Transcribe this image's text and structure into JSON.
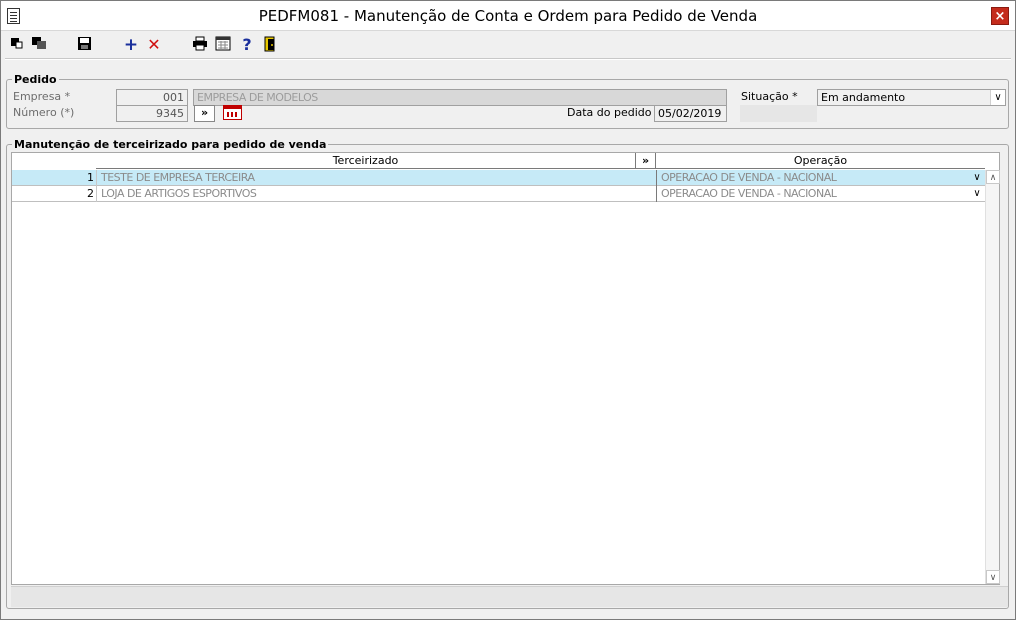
{
  "window": {
    "title": "PEDFM081 - Manutenção de Conta e Ordem para Pedido de Venda",
    "close_label": "×"
  },
  "toolbar": {
    "plus_label": "+",
    "x_label": "✕",
    "help_label": "?"
  },
  "pedido": {
    "group_title": "Pedido",
    "empresa_label": "Empresa *",
    "empresa_value": "001",
    "empresa_name": "EMPRESA DE MODELOS",
    "numero_label": "Número (*)",
    "numero_value": "9345",
    "more_button": "»",
    "data_label": "Data do pedido *",
    "data_value": "05/02/2019",
    "situacao_label": "Situação *",
    "situacao_value": "Em andamento"
  },
  "manutencao": {
    "group_title": "Manutenção de terceirizado para pedido de venda",
    "col_terceirizado": "Terceirizado",
    "col_more": "»",
    "col_operacao": "Operação",
    "rows": [
      {
        "num": "1",
        "terceirizado": "TESTE DE EMPRESA TERCEIRA",
        "operacao": "OPERACAO DE VENDA - NACIONAL"
      },
      {
        "num": "2",
        "terceirizado": "LOJA DE ARTIGOS ESPORTIVOS",
        "operacao": "OPERACAO DE VENDA - NACIONAL"
      }
    ]
  }
}
